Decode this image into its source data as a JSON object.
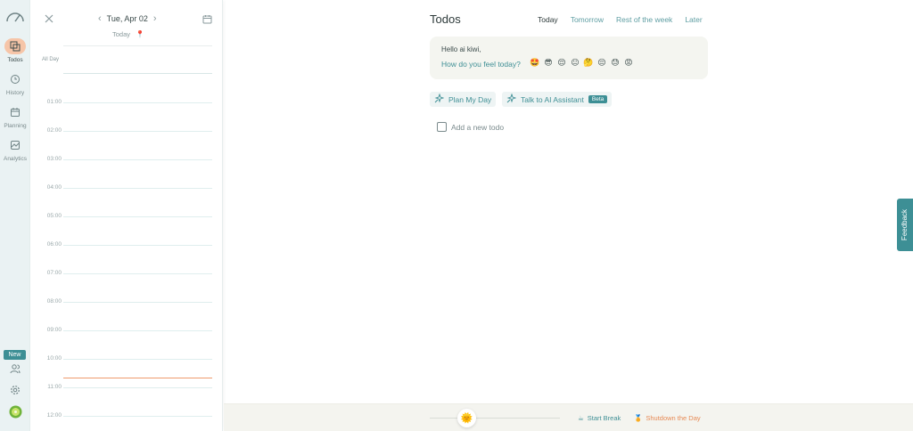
{
  "sidebar": {
    "items": [
      {
        "label": "Todos",
        "icon": "todos-icon",
        "active": true
      },
      {
        "label": "History",
        "icon": "history-icon",
        "active": false
      },
      {
        "label": "Planning",
        "icon": "planning-icon",
        "active": false
      },
      {
        "label": "Analytics",
        "icon": "analytics-icon",
        "active": false
      }
    ],
    "new_badge": "New"
  },
  "calendar": {
    "date": "Tue, Apr 02",
    "today_label": "Today",
    "all_day_label": "All Day",
    "hours": [
      "01:00",
      "02:00",
      "03:00",
      "04:00",
      "05:00",
      "06:00",
      "07:00",
      "08:00",
      "09:00",
      "10:00",
      "11:00",
      "12:00"
    ]
  },
  "main": {
    "title": "Todos",
    "tabs": [
      "Today",
      "Tomorrow",
      "Rest of the week",
      "Later"
    ],
    "active_tab": "Today",
    "greeting": {
      "hello": "Hello ai kiwi,",
      "question": "How do you feel today?",
      "emojis": [
        "🤩",
        "😎",
        "😌",
        "😐",
        "🤔",
        "😔",
        "😓",
        "😡"
      ]
    },
    "plan_label": "Plan My Day",
    "assistant_label": "Talk to AI Assistant",
    "beta_label": "Beta",
    "add_todo_label": "Add a new todo"
  },
  "feedback_label": "Feedback",
  "bottom_bar": {
    "start_break": "Start Break",
    "shutdown": "Shutdown the Day"
  },
  "colors": {
    "accent": "#3d8f95",
    "active_nav": "#f6c5a8",
    "now_line": "#ee9a6c",
    "shutdown": "#e78a55"
  }
}
